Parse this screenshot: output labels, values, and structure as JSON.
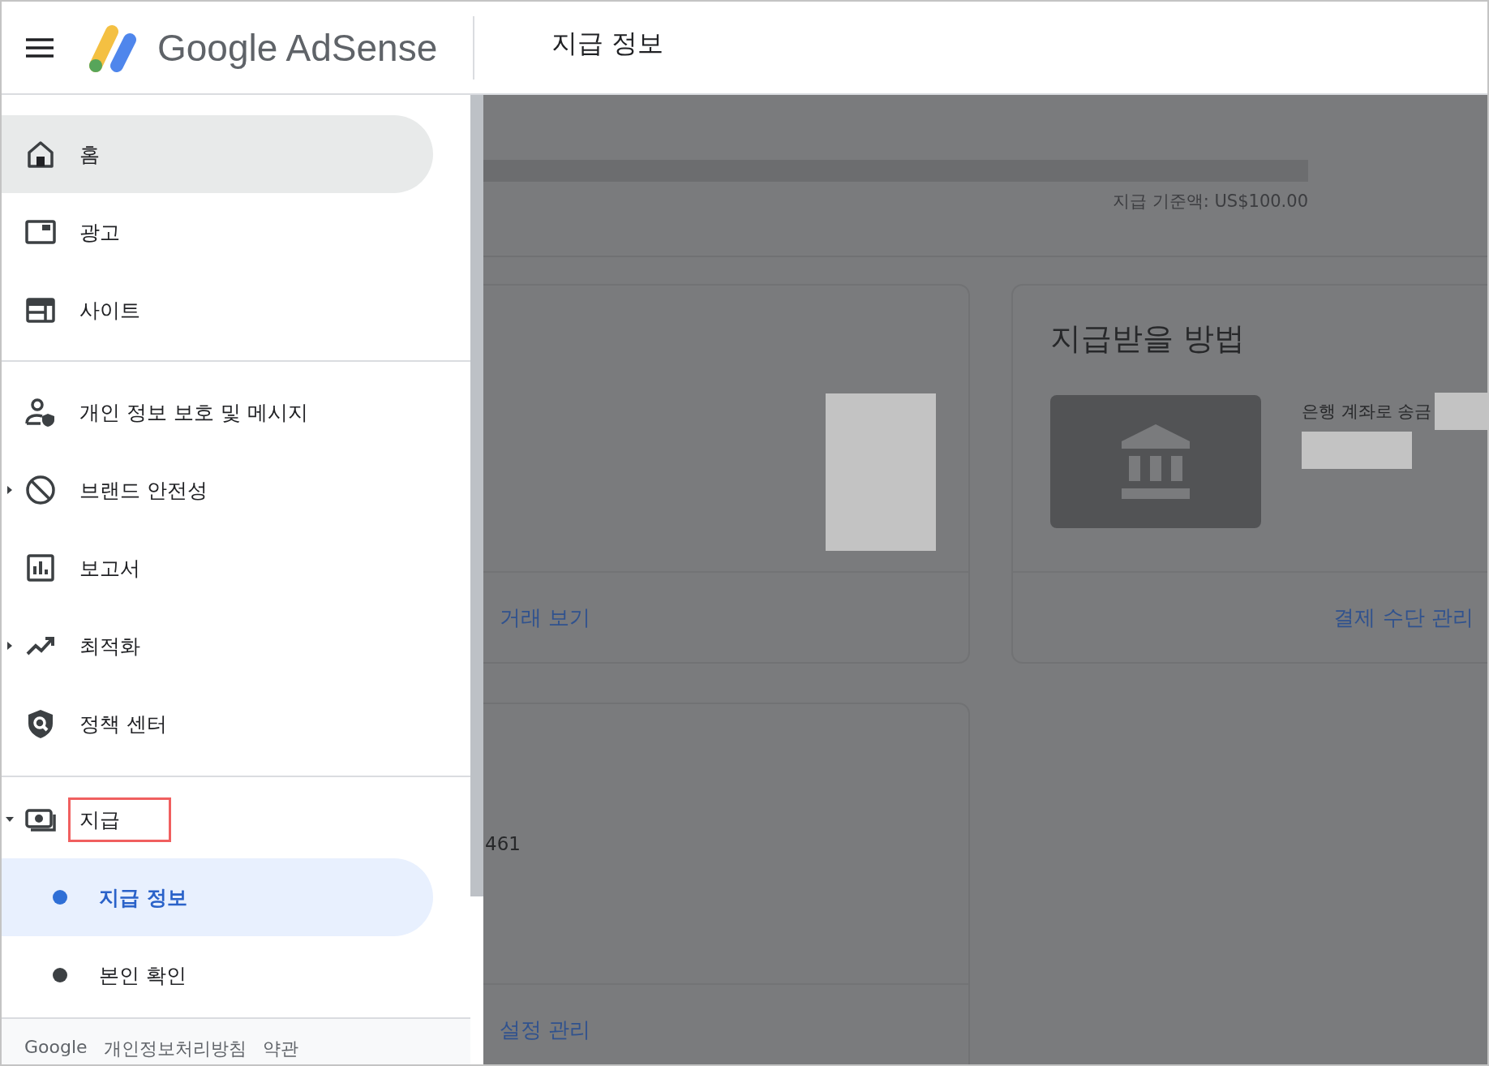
{
  "header": {
    "logo_text": "Google AdSense",
    "page_title": "지급 정보"
  },
  "sidebar": {
    "sections": [
      {
        "items": [
          {
            "label": "홈",
            "selected": true
          },
          {
            "label": "광고",
            "selected": false
          },
          {
            "label": "사이트",
            "selected": false
          }
        ]
      },
      {
        "items": [
          {
            "label": "개인 정보 보호 및 메시지",
            "selected": false
          },
          {
            "label": "브랜드 안전성",
            "selected": false,
            "expanded": false
          },
          {
            "label": "보고서",
            "selected": false
          },
          {
            "label": "최적화",
            "selected": false,
            "expanded": false
          },
          {
            "label": "정책 센터",
            "selected": false
          }
        ]
      },
      {
        "items": [
          {
            "label": "지급",
            "selected": false,
            "expanded": true,
            "outlined": true,
            "children": [
              {
                "label": "지급 정보",
                "selected": true
              },
              {
                "label": "본인 확인",
                "selected": false
              }
            ]
          }
        ]
      }
    ],
    "footer": [
      "Google",
      "개인정보처리방침",
      "약관"
    ]
  },
  "content": {
    "threshold": "지급 기준액: US$100.00",
    "cards": [
      {
        "kind": "summary",
        "link": "거래 보기"
      },
      {
        "kind": "payment_method",
        "title": "지급받을 방법",
        "method": "은행 계좌로 송금",
        "link": "결제 수단 관리"
      },
      {
        "kind": "settings",
        "value": "461",
        "link": "설정 관리"
      }
    ]
  }
}
